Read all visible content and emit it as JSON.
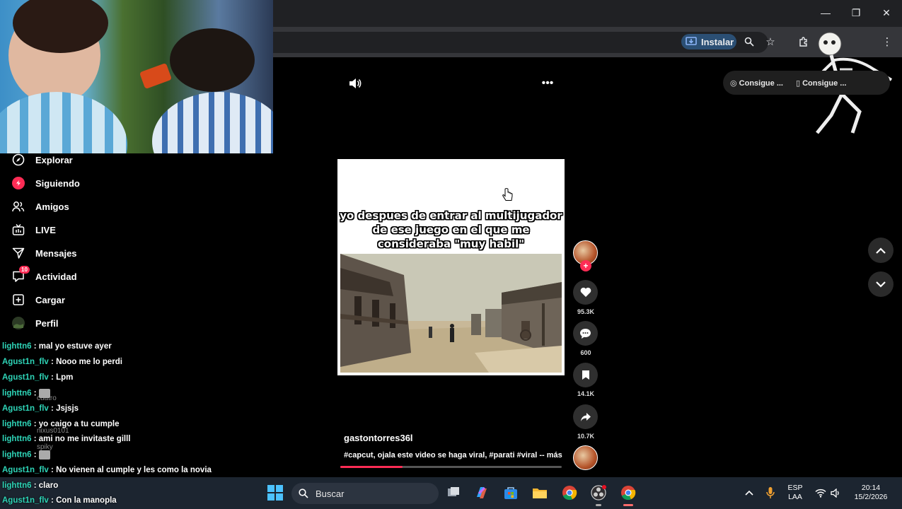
{
  "browser": {
    "install_label": "Instalar",
    "window_controls": {
      "minimize": "—",
      "restore": "❐",
      "close": "✕"
    },
    "toolbar_icons": [
      "zoom-icon",
      "bookmark-star-icon",
      "extensions-icon",
      "menu-dots-icon"
    ]
  },
  "video_controls": {
    "promo_pill_1": "Consigue ...",
    "promo_pill_2": "Consigue ..."
  },
  "sidebar": {
    "items": [
      {
        "label": "Explorar",
        "icon": "compass-icon"
      },
      {
        "label": "Siguiendo",
        "icon": "following-icon"
      },
      {
        "label": "Amigos",
        "icon": "friends-icon"
      },
      {
        "label": "LIVE",
        "icon": "live-icon"
      },
      {
        "label": "Mensajes",
        "icon": "messages-icon"
      },
      {
        "label": "Actividad",
        "icon": "activity-icon",
        "badge": "10"
      },
      {
        "label": "Cargar",
        "icon": "upload-icon"
      },
      {
        "label": "Perfil",
        "icon": "profile-icon"
      }
    ]
  },
  "chat": {
    "messages": [
      {
        "user": "lighttn6",
        "text": "mal yo estuve ayer"
      },
      {
        "user": "Agust1n_flv",
        "text": "Nooo me lo perdi"
      },
      {
        "user": "Agust1n_flv",
        "text": "Lpm"
      },
      {
        "user": "lighttn6",
        "text": ""
      },
      {
        "user": "Agust1n_flv",
        "text": "Jsjsjs"
      },
      {
        "user": "lighttn6",
        "text": "yo caigo a tu cumple"
      },
      {
        "user": "lighttn6",
        "text": "ami no me invitaste gilll"
      },
      {
        "user": "lighttn6",
        "text": ""
      },
      {
        "user": "Agust1n_flv",
        "text": "No vienen al cumple y les como la novia"
      },
      {
        "user": "lighttn6",
        "text": "claro"
      },
      {
        "user": "Agust1n_flv",
        "text": "Con la manopla"
      }
    ],
    "separator": " : ",
    "ghost_labels": [
      "cuatro",
      "nixus0101",
      "spiky"
    ]
  },
  "video": {
    "caption": "yo despues de entrar al multijugador de ese juego en el que me consideraba \"muy habil\"",
    "author": "gastontorres36l",
    "description": "#capcut, ojala este video se haga viral, #parati #viral --  más",
    "progress": 0.28
  },
  "actions": {
    "likes": "95.3K",
    "comments": "600",
    "saves": "14.1K",
    "shares": "10.7K"
  },
  "taskbar": {
    "search_label": "Buscar",
    "lang_top": "ESP",
    "lang_bottom": "LAA",
    "time": "20:14",
    "date": "15/2/2026"
  },
  "colors": {
    "accent": "#fe2c55",
    "chat_user": "#2ed4b7",
    "install_bg": "#2b4f74"
  }
}
